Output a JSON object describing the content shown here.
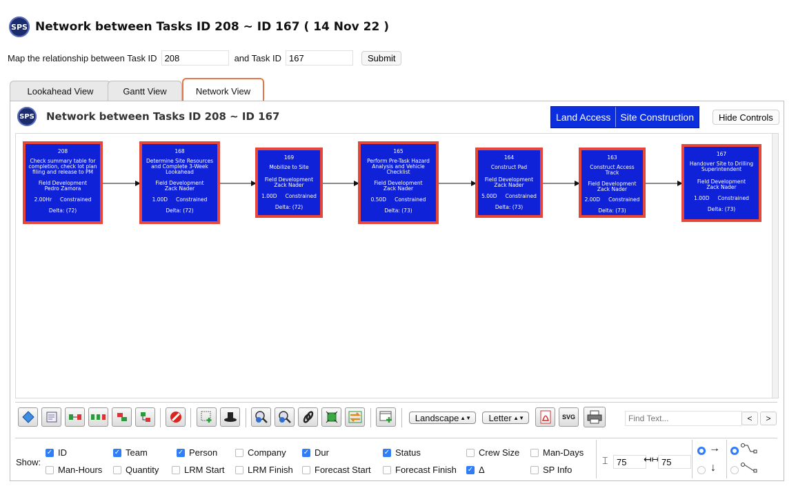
{
  "header": {
    "logo_text": "SPS",
    "title": "Network between Tasks ID 208 ~ ID 167 ( 14 Nov 22 )"
  },
  "mapline": {
    "label1": "Map the relationship between Task ID",
    "task_from": "208",
    "label2": "and Task ID",
    "task_to": "167",
    "submit": "Submit"
  },
  "tabs": [
    {
      "label": "Lookahead View"
    },
    {
      "label": "Gantt View"
    },
    {
      "label": "Network View",
      "active": true
    }
  ],
  "panel": {
    "logo_text": "SPS",
    "title": "Network between Tasks ID 208 ~ ID 167",
    "legend": [
      "Land Access",
      "Site Construction"
    ],
    "hide_controls": "Hide Controls"
  },
  "nodes": [
    {
      "id": "208",
      "name": "Check summary table for completion, check lot plan filing and release to PM",
      "team": "Field Development",
      "person": "Pedro Zamora",
      "dur": "2.00Hr",
      "status": "Constrained",
      "delta": "Delta: (72)"
    },
    {
      "id": "168",
      "name": "Determine Site Resources and Complete 3-Week Lookahead",
      "team": "Field Development",
      "person": "Zack Nader",
      "dur": "1.00D",
      "status": "Constrained",
      "delta": "Delta: (72)"
    },
    {
      "id": "169",
      "name": "Mobilize to Site",
      "team": "Field Development",
      "person": "Zack Nader",
      "dur": "1.00D",
      "status": "Constrained",
      "delta": "Delta: (72)"
    },
    {
      "id": "165",
      "name": "Perform Pre-Task Hazard Analysis and Vehicle Checklist",
      "team": "Field Development",
      "person": "Zack Nader",
      "dur": "0.50D",
      "status": "Constrained",
      "delta": "Delta: (73)"
    },
    {
      "id": "164",
      "name": "Construct Pad",
      "team": "Field Development",
      "person": "Zack Nader",
      "dur": "5.00D",
      "status": "Constrained",
      "delta": "Delta: (73)"
    },
    {
      "id": "163",
      "name": "Construct Access Track",
      "team": "Field Development",
      "person": "Zack Nader",
      "dur": "2.00D",
      "status": "Constrained",
      "delta": "Delta: (73)"
    },
    {
      "id": "167",
      "name": "Handover Site to Drilling Superintendent",
      "team": "Field Development",
      "person": "Zack Nader",
      "dur": "1.00D",
      "status": "Constrained",
      "delta": "Delta: (73)"
    }
  ],
  "toolbar": {
    "icons": [
      "diamond-icon",
      "edit-form-icon",
      "link-tasks-icon",
      "link-chain-icon",
      "unlink-icon",
      "reorder-icon",
      "cancel-icon",
      "zoom-fit-add-icon",
      "hat-icon",
      "zoom-in-icon",
      "zoom-out-icon",
      "chain-icon",
      "fit-page-icon",
      "refresh-icon",
      "add-frame-icon",
      "pdf-icon",
      "svg-icon",
      "print-icon"
    ],
    "orientation": "Landscape",
    "paper": "Letter",
    "svg_label": "SVG",
    "find_placeholder": "Find Text...",
    "prev": "<",
    "next": ">"
  },
  "show": {
    "label": "Show:",
    "row1": [
      {
        "label": "ID",
        "checked": true
      },
      {
        "label": "Team",
        "checked": true
      },
      {
        "label": "Person",
        "checked": true
      },
      {
        "label": "Company",
        "checked": false
      },
      {
        "label": "Dur",
        "checked": true
      },
      {
        "label": "Status",
        "checked": true
      },
      {
        "label": "Crew Size",
        "checked": false
      },
      {
        "label": "Man-Days",
        "checked": false
      }
    ],
    "row2": [
      {
        "label": "Man-Hours",
        "checked": false
      },
      {
        "label": "Quantity",
        "checked": false
      },
      {
        "label": "LRM Start",
        "checked": false
      },
      {
        "label": "LRM Finish",
        "checked": false
      },
      {
        "label": "Forecast Start",
        "checked": false
      },
      {
        "label": "Forecast Finish",
        "checked": false
      },
      {
        "label": "Δ",
        "checked": true
      },
      {
        "label": "SP Info",
        "checked": false
      }
    ],
    "v_spacing": "75",
    "h_spacing": "75"
  }
}
